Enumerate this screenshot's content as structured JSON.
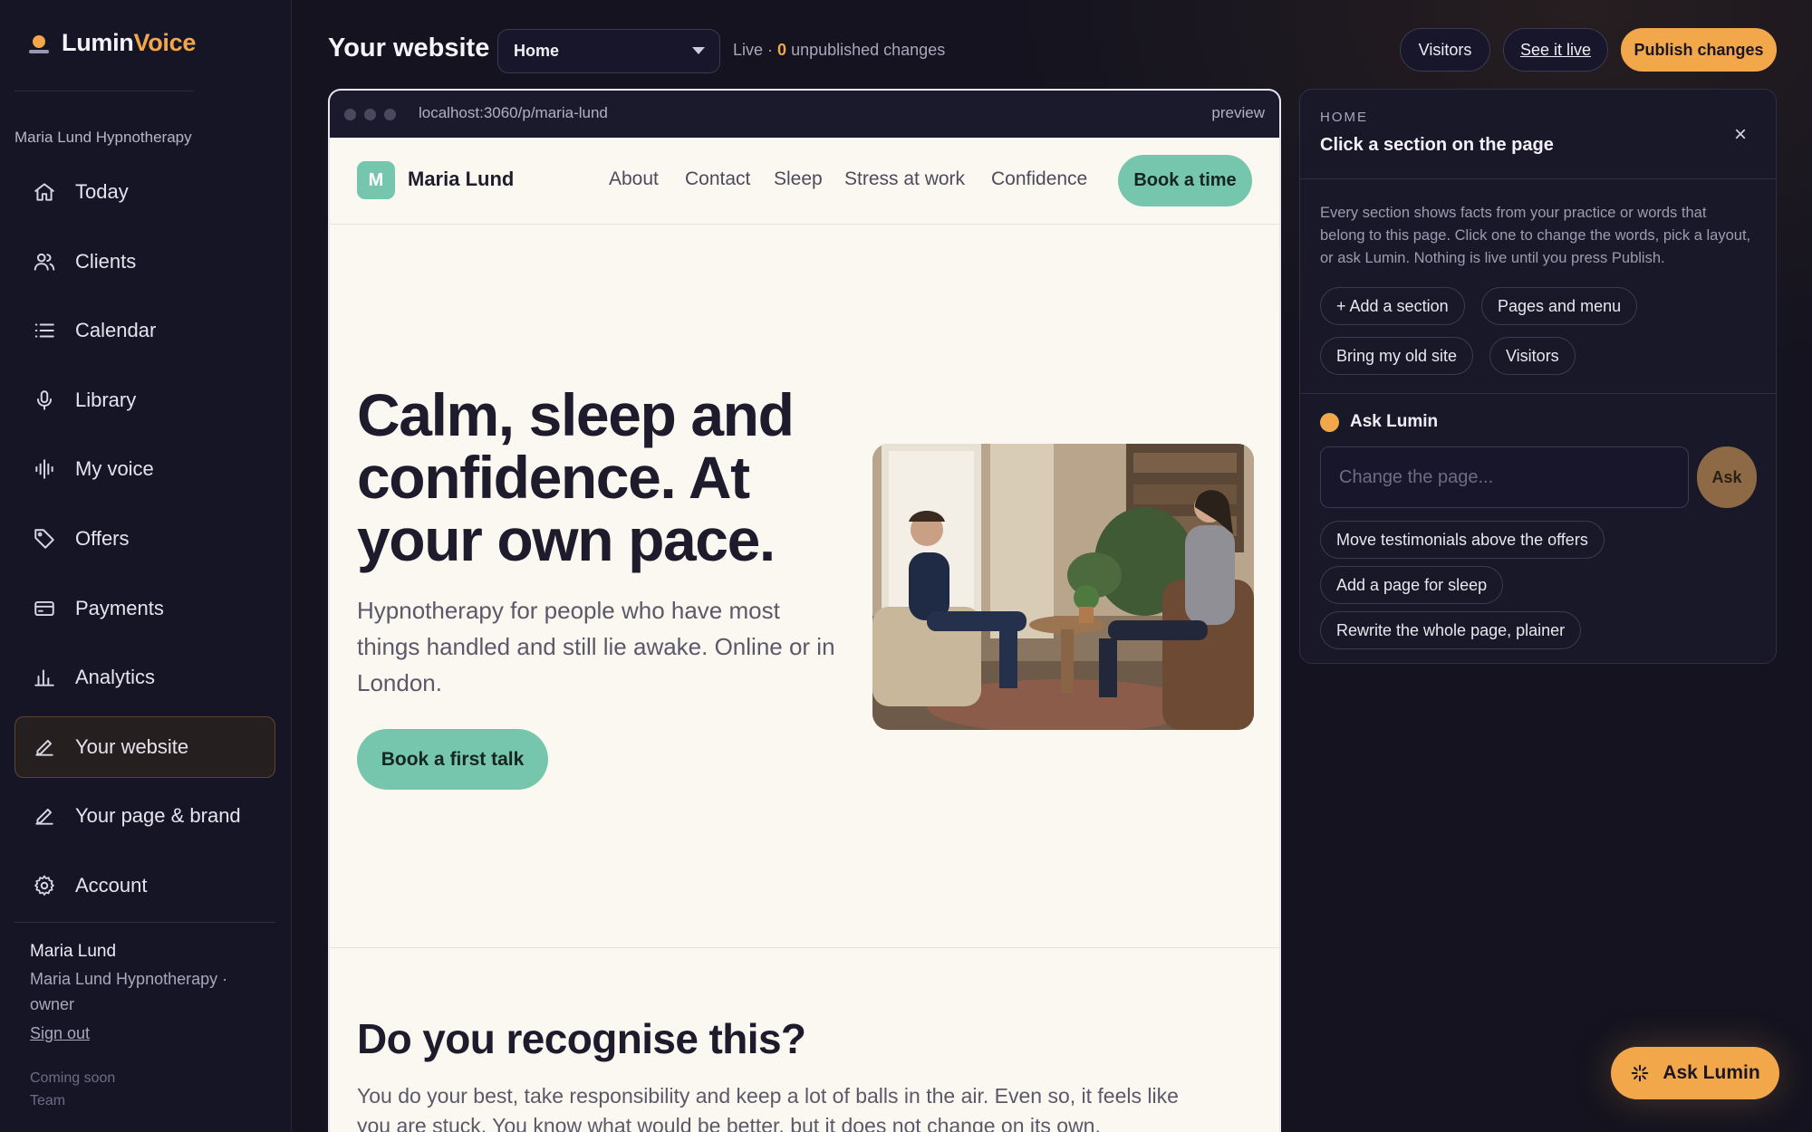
{
  "brand": {
    "name_part1": "Lumin",
    "name_part2": "Voice"
  },
  "sidebar": {
    "practice": "Maria Lund Hypnotherapy",
    "items": [
      {
        "label": "Today",
        "icon": "home-icon"
      },
      {
        "label": "Clients",
        "icon": "users-icon"
      },
      {
        "label": "Calendar",
        "icon": "list-icon"
      },
      {
        "label": "Library",
        "icon": "microphone-icon"
      },
      {
        "label": "My voice",
        "icon": "waveform-icon"
      },
      {
        "label": "Offers",
        "icon": "tag-icon"
      },
      {
        "label": "Payments",
        "icon": "credit-card-icon"
      },
      {
        "label": "Analytics",
        "icon": "bar-chart-icon"
      },
      {
        "label": "Your website",
        "icon": "edit-icon",
        "active": true
      },
      {
        "label": "Your page & brand",
        "icon": "edit-icon"
      },
      {
        "label": "Account",
        "icon": "gear-icon"
      }
    ],
    "user_name": "Maria Lund",
    "user_role": "Maria Lund Hypnotherapy · owner",
    "sign_out": "Sign out",
    "coming_soon": "Coming soon",
    "team": "Team"
  },
  "topbar": {
    "title": "Your website",
    "page_select": "Home",
    "live": "Live ·",
    "unpublished_count": "0",
    "unpublished_text": "unpublished changes",
    "visitors": "Visitors",
    "see_live": "See it live",
    "publish": "Publish changes"
  },
  "preview": {
    "url": "localhost:3060/p/maria-lund",
    "tag": "preview",
    "site": {
      "logo_letter": "M",
      "name": "Maria Lund",
      "nav": [
        "About",
        "Contact",
        "Sleep",
        "Stress at work",
        "Confidence"
      ],
      "book": "Book a time",
      "hero_title": "Calm, sleep and confidence. At your own pace.",
      "hero_sub": "Hypnotherapy for people who have most things handled and still lie awake. Online or in London.",
      "hero_button": "Book a first talk",
      "section2_title": "Do you recognise this?",
      "section2_body": "You do your best, take responsibility and keep a lot of balls in the air. Even so, it feels like you are stuck. You know what would be better, but it does not change on its own."
    }
  },
  "panel": {
    "eyebrow": "HOME",
    "title": "Click a section on the page",
    "close": "×",
    "description": "Every section shows facts from your practice or words that belong to this page. Click one to change the words, pick a layout, or ask Lumin. Nothing is live until you press Publish.",
    "chips": [
      "+ Add a section",
      "Pages and menu",
      "Bring my old site",
      "Visitors"
    ],
    "ask_label": "Ask Lumin",
    "ask_placeholder": "Change the page...",
    "ask_button": "Ask",
    "suggestions": [
      "Move testimonials above the offers",
      "Add a page for sleep",
      "Rewrite the whole page, plainer"
    ]
  },
  "float_button": "Ask Lumin",
  "colors": {
    "accent": "#f2a74a",
    "site_green": "#76c6ae",
    "bg": "#14131f"
  }
}
